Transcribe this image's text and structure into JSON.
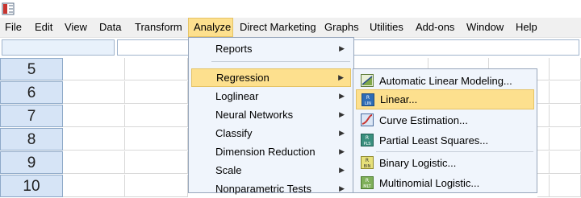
{
  "menubar": {
    "items": [
      {
        "label": "File"
      },
      {
        "label": "Edit"
      },
      {
        "label": "View"
      },
      {
        "label": "Data"
      },
      {
        "label": "Transform"
      },
      {
        "label": "Analyze"
      },
      {
        "label": "Direct Marketing"
      },
      {
        "label": "Graphs"
      },
      {
        "label": "Utilities"
      },
      {
        "label": "Add-ons"
      },
      {
        "label": "Window"
      },
      {
        "label": "Help"
      }
    ]
  },
  "grid": {
    "row_numbers": [
      "5",
      "6",
      "7",
      "8",
      "9",
      "10"
    ]
  },
  "analyze_menu": {
    "items": [
      {
        "label": "Reports"
      },
      {
        "label": "Regression"
      },
      {
        "label": "Loglinear"
      },
      {
        "label": "Neural Networks"
      },
      {
        "label": "Classify"
      },
      {
        "label": "Dimension Reduction"
      },
      {
        "label": "Scale"
      },
      {
        "label": "Nonparametric Tests"
      }
    ],
    "highlighted": "Regression"
  },
  "regression_submenu": {
    "items": [
      {
        "label": "Automatic Linear Modeling...",
        "icon": "automatic-linear-modeling-icon"
      },
      {
        "label": "Linear...",
        "icon": "linear-regression-icon"
      },
      {
        "label": "Curve Estimation...",
        "icon": "curve-estimation-icon"
      },
      {
        "label": "Partial Least Squares...",
        "icon": "partial-least-squares-icon"
      },
      {
        "label": "Binary Logistic...",
        "icon": "binary-logistic-icon"
      },
      {
        "label": "Multinomial Logistic...",
        "icon": "multinomial-logistic-icon"
      }
    ],
    "highlighted": "Linear..."
  },
  "colors": {
    "highlight": "#fde08e",
    "menu_background": "#f0f5fc",
    "row_header": "#d6e4f6"
  }
}
